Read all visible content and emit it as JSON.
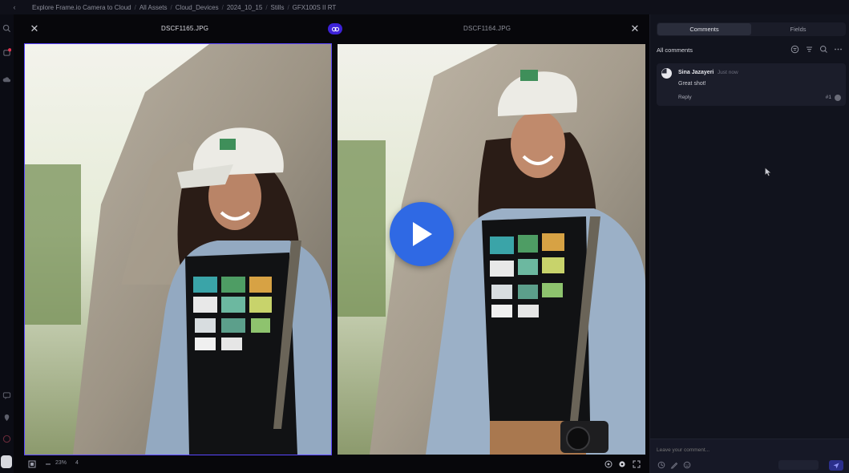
{
  "topbar": {
    "back_icon": "chevron-left-icon",
    "breadcrumbs": [
      "Explore Frame.io Camera to Cloud",
      "All Assets",
      "Cloud_Devices",
      "2024_10_15",
      "Stills",
      "GFX100S II RT"
    ]
  },
  "rail": {
    "icons": [
      "search-icon",
      "notification-icon",
      "cloud-icon",
      "chat-icon",
      "location-icon",
      "help-icon",
      "account-icon"
    ],
    "notification_badge": ""
  },
  "viewer": {
    "left_file": "DSCF1165.JPG",
    "right_file": "DSCF1164.JPG",
    "compare_icon": "compare-icon",
    "footer": {
      "zoom": "23%",
      "frame_count": "4"
    }
  },
  "panel": {
    "tabs": [
      {
        "label": "Comments",
        "active": true
      },
      {
        "label": "Fields",
        "active": false
      }
    ],
    "title": "All comments",
    "tools": [
      "filter-circle-icon",
      "sort-icon",
      "search-icon",
      "more-icon"
    ],
    "comment": {
      "author": "Sina Jazayeri",
      "time": "Just now",
      "text": "Great shot!",
      "reply_label": "Reply",
      "index": "#1"
    },
    "composer": {
      "placeholder": "Leave your comment...",
      "tools": [
        "attach-icon",
        "draw-icon",
        "emoji-icon"
      ],
      "option_label": "",
      "send_icon": "send-icon"
    }
  },
  "colors": {
    "accent": "#2f69e4",
    "toggle": "#3d22d8",
    "panel_bg": "#11131d"
  }
}
